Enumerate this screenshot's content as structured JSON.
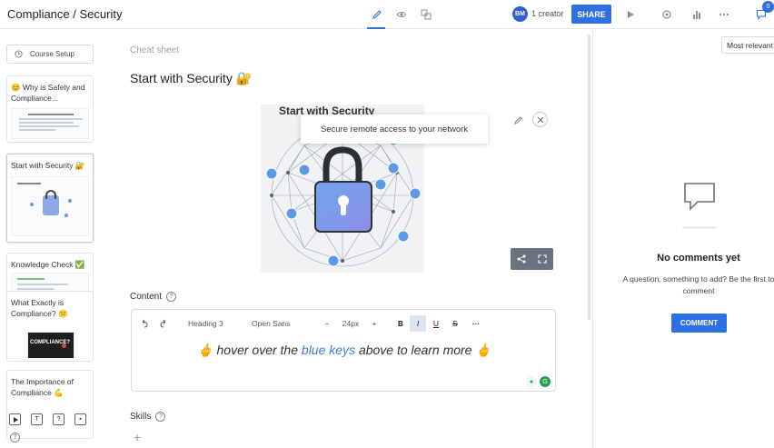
{
  "header": {
    "title": "Compliance / Security",
    "creator_initials": "BM",
    "creator_text": "1 creator",
    "share_label": "SHARE",
    "notification_count": "0"
  },
  "sidebar": {
    "course_setup": "Course Setup",
    "slides": [
      {
        "label": "😊 Why is Safety and Compliance..."
      },
      {
        "label": "Start with Security 🔐"
      },
      {
        "label": "Knowledge Check ✅"
      },
      {
        "label": "What Exactly is Compliance? 😕"
      },
      {
        "label": "The Importance of Compliance 💪"
      }
    ],
    "thumb_compliance_text": "COMPLIANCE?"
  },
  "main": {
    "cheatsheet": "Cheat sheet",
    "heading": "Start with Security 🔐",
    "image_title": "Start with Security",
    "tooltip": "Secure remote access to your network",
    "content_label": "Content",
    "toolbar": {
      "style": "Heading 3",
      "font": "Open Sans",
      "size": "24px"
    },
    "editor_text_before": "🖕 hover over the ",
    "editor_text_keys": "blue keys",
    "editor_text_after": " above to learn more 🖕",
    "skills_label": "Skills",
    "add_symbol": "+"
  },
  "comments": {
    "filter": "Most relevant",
    "empty_title": "No comments yet",
    "empty_sub": "A question, something to add? Be the first to comment",
    "button": "COMMENT"
  },
  "colors": {
    "accent": "#2f6fe4",
    "lock": "#6b8fe0"
  }
}
